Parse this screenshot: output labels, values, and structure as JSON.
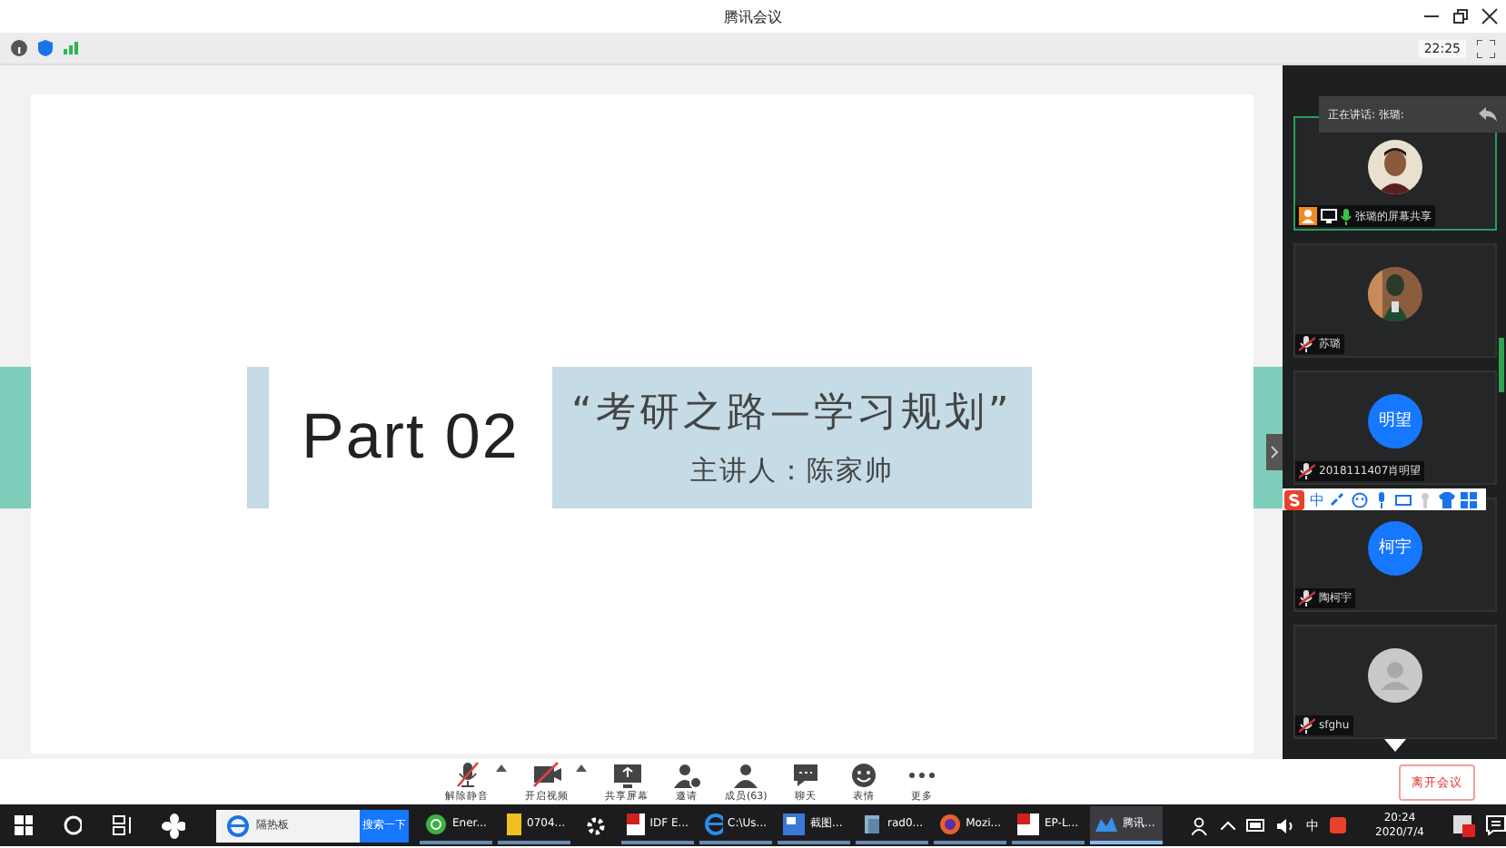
{
  "window": {
    "title": "腾讯会议",
    "clock": "22:25"
  },
  "slide": {
    "heading": "Part 02",
    "title": "“考研之路—学习规划”",
    "speaker": "主讲人：陈家帅"
  },
  "speaking_banner": "正在讲话: 张璐:",
  "participants": [
    {
      "name": "张璐的屏幕共享",
      "speaking": true,
      "sharing": true
    },
    {
      "name": "苏璐",
      "kind": "photo2",
      "speaking": false,
      "sharing": false
    },
    {
      "name": "2018111407肖明望",
      "kind": "initials",
      "initials": "明望",
      "speaking": false,
      "sharing": false
    },
    {
      "name": "陶柯宇",
      "kind": "initials",
      "initials": "柯宇",
      "speaking": false,
      "sharing": false
    },
    {
      "name": "sfghu",
      "kind": "default",
      "speaking": false,
      "sharing": false
    }
  ],
  "ime_bar": {
    "mode": "中"
  },
  "toolbar": [
    {
      "label": "解除静音",
      "has_menu": true
    },
    {
      "label": "开启视频",
      "has_menu": true
    },
    {
      "label": "共享屏幕",
      "has_menu": false
    },
    {
      "label": "邀请",
      "has_menu": false
    },
    {
      "label": "成员(63)",
      "has_menu": false
    },
    {
      "label": "聊天",
      "has_menu": false
    },
    {
      "label": "表情",
      "has_menu": false
    },
    {
      "label": "更多",
      "has_menu": false
    }
  ],
  "leave_button": "离开会议",
  "taskbar": {
    "search_text": "隔热板",
    "search_button": "搜索一下",
    "apps": [
      {
        "label": "Ener...",
        "selected": false
      },
      {
        "label": "0704...",
        "selected": false
      },
      {
        "label": "IDF E...",
        "selected": false
      },
      {
        "label": "C:\\Us...",
        "selected": false
      },
      {
        "label": "截图...",
        "selected": false
      },
      {
        "label": "rad0...",
        "selected": false
      },
      {
        "label": "Mozi...",
        "selected": false
      },
      {
        "label": "EP-L...",
        "selected": false
      },
      {
        "label": "腾讯...",
        "selected": true
      }
    ],
    "ime": "中",
    "time": "20:24",
    "date": "2020/7/4"
  }
}
